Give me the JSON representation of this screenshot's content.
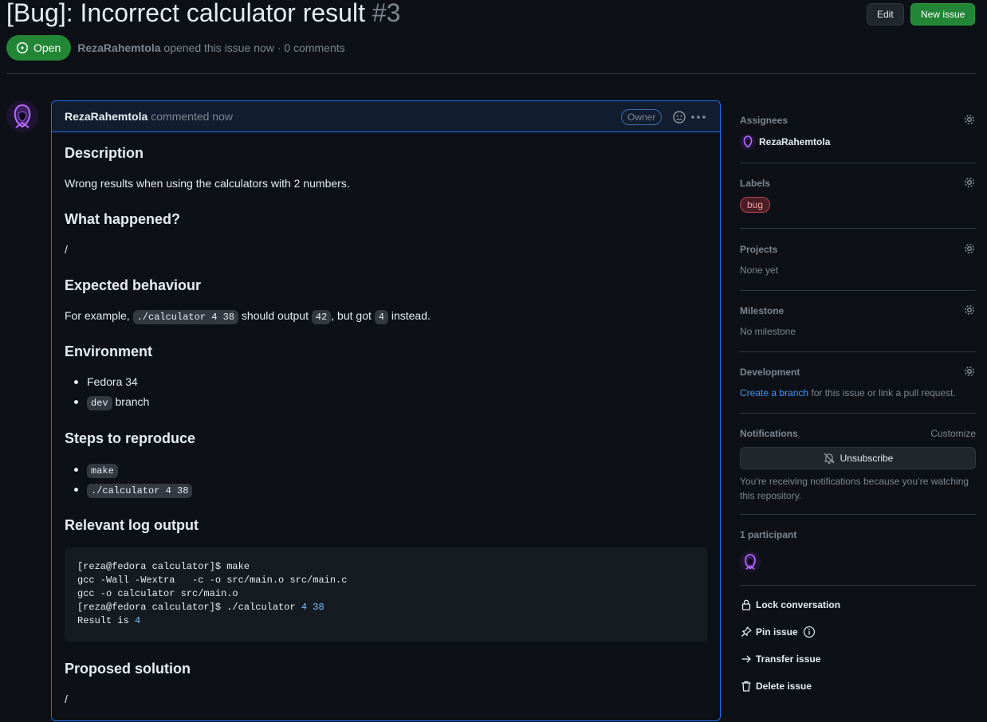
{
  "header": {
    "title": "[Bug]: Incorrect calculator result",
    "number": "#3",
    "edit_label": "Edit",
    "new_issue_label": "New issue",
    "state": "Open",
    "author": "RezaRahemtola",
    "meta_suffix": "opened this issue now · 0 comments"
  },
  "comment": {
    "author": "RezaRahemtola",
    "time": "commented now",
    "badge": "Owner",
    "sections": {
      "description_heading": "Description",
      "description_text": "Wrong results when using the calculators with 2 numbers.",
      "happened_heading": "What happened?",
      "happened_text": "/",
      "expected_heading": "Expected behaviour",
      "expected_prefix": "For example,",
      "expected_code1": "./calculator 4 38",
      "expected_mid": "should output",
      "expected_code2": "42",
      "expected_mid2": ", but got",
      "expected_code3": "4",
      "expected_suffix": "instead.",
      "environment_heading": "Environment",
      "env_item1": "Fedora 34",
      "env_item2_code": "dev",
      "env_item2_text": "branch",
      "steps_heading": "Steps to reproduce",
      "step1_code": "make",
      "step2_code": "./calculator 4 38",
      "log_heading": "Relevant log output",
      "log_line1": "[reza@fedora calculator]$ make",
      "log_line2": "gcc -Wall -Wextra   -c -o src/main.o src/main.c",
      "log_line3": "gcc -o calculator src/main.o",
      "log_line4_prefix": "[reza@fedora calculator]$ ./calculator ",
      "log_line4_nums": "4 38",
      "log_line5_prefix": "Result is ",
      "log_line5_num": "4",
      "solution_heading": "Proposed solution",
      "solution_text": "/"
    }
  },
  "sidebar": {
    "assignees_title": "Assignees",
    "assignee": "RezaRahemtola",
    "labels_title": "Labels",
    "label": "bug",
    "projects_title": "Projects",
    "projects_value": "None yet",
    "milestone_title": "Milestone",
    "milestone_value": "No milestone",
    "development_title": "Development",
    "development_link": "Create a branch",
    "development_text": "for this issue or link a pull request.",
    "notifications_title": "Notifications",
    "customize": "Customize",
    "unsubscribe": "Unsubscribe",
    "notifications_text1": "You’re receiving notifications because you’re watching",
    "notifications_text2": "this repository.",
    "participants_title": "1 participant",
    "lock": "Lock conversation",
    "pin": "Pin issue",
    "transfer": "Transfer issue",
    "delete": "Delete issue"
  },
  "colors": {
    "background": "#0d1117",
    "open_green": "#238636",
    "accent_blue": "#1f6feb",
    "label_bug": "#b4434f"
  },
  "icons": {
    "state": "issue-opened-icon",
    "emoji": "smiley-icon",
    "more": "kebab-horizontal-icon",
    "gear": "gear-icon",
    "unsubscribe": "bell-slash-icon",
    "lock": "lock-icon",
    "pin": "pin-icon",
    "info": "info-icon",
    "transfer": "arrow-right-icon",
    "delete": "trash-icon"
  }
}
